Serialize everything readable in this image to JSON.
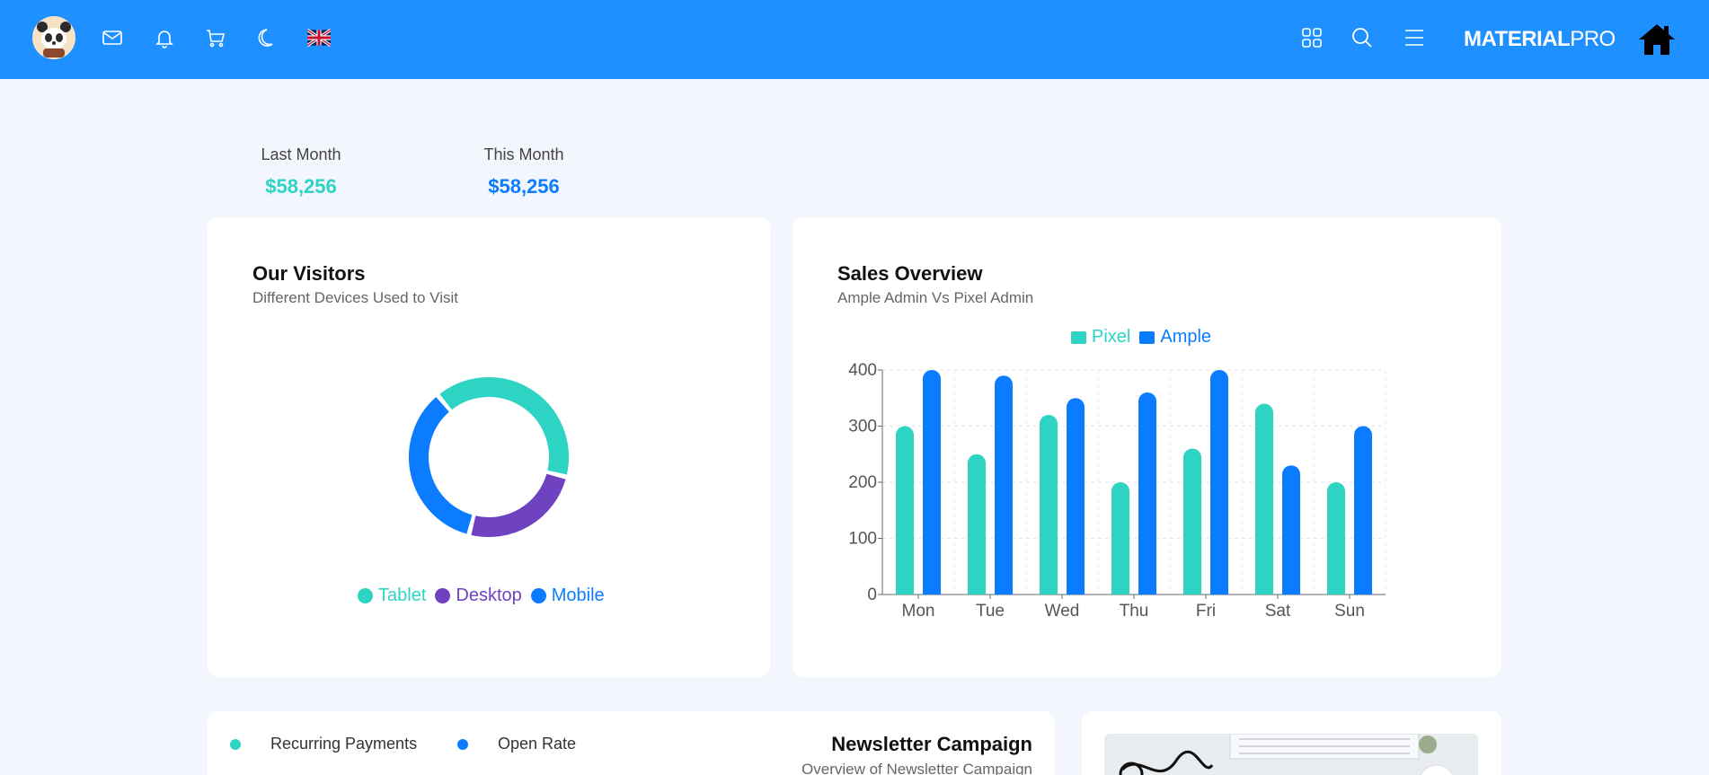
{
  "header": {
    "brand_bold": "MATERIAL",
    "brand_light": "PRO",
    "icons": [
      "mail-icon",
      "bell-icon",
      "cart-icon",
      "moon-icon",
      "uk-flag-icon",
      "apps-grid-icon",
      "search-icon",
      "menu-icon",
      "home-icon"
    ],
    "bg_color": "#1e90ff"
  },
  "stats": {
    "last_month_label": "Last Month",
    "last_month_value": "$58,256",
    "this_month_label": "This Month",
    "this_month_value": "$58,256"
  },
  "visitors": {
    "title": "Our Visitors",
    "subtitle": "Different Devices Used to Visit",
    "legend": [
      {
        "name": "Tablet",
        "color": "#2dd4c4"
      },
      {
        "name": "Desktop",
        "color": "#6f42c1"
      },
      {
        "name": "Mobile",
        "color": "#0b7cff"
      }
    ]
  },
  "sales": {
    "title": "Sales Overview",
    "subtitle": "Ample Admin Vs Pixel Admin"
  },
  "chart_data": [
    {
      "type": "pie",
      "variant": "donut",
      "labels": [
        "Tablet",
        "Desktop",
        "Mobile"
      ],
      "values": [
        40,
        25,
        35
      ],
      "colors": [
        "#2dd4c4",
        "#6f42c1",
        "#0b7cff"
      ]
    },
    {
      "type": "bar",
      "categories": [
        "Mon",
        "Tue",
        "Wed",
        "Thu",
        "Fri",
        "Sat",
        "Sun"
      ],
      "series": [
        {
          "name": "Pixel",
          "values": [
            300,
            250,
            320,
            200,
            260,
            340,
            200
          ],
          "color": "#2dd4c4"
        },
        {
          "name": "Ample",
          "values": [
            400,
            390,
            350,
            360,
            400,
            230,
            300
          ],
          "color": "#0b7cff"
        }
      ],
      "ylim": [
        0,
        400
      ],
      "yticks": [
        0,
        100,
        200,
        300,
        400
      ],
      "grid": true,
      "legend_position": "top"
    }
  ],
  "newsletter": {
    "title": "Newsletter Campaign",
    "subtitle": "Overview of Newsletter Campaign",
    "legend": [
      {
        "name": "Recurring Payments",
        "color": "#2dd4c4"
      },
      {
        "name": "Open Rate",
        "color": "#0b7cff"
      }
    ]
  }
}
